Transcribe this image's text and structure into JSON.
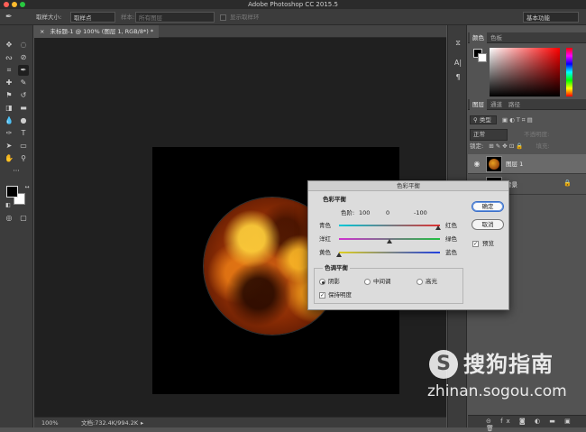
{
  "app": {
    "title": "Adobe Photoshop CC 2015.5"
  },
  "options_bar": {
    "sample_size_label": "取样大小:",
    "sample_size_value": "取样点",
    "sample_label": "样本:",
    "sample_value": "所有图层",
    "show_ring_label": "显示取样环",
    "workspace": "基本功能"
  },
  "document": {
    "tab_title": "未标题-1 @ 100% (图层 1, RGB/8*) *",
    "zoom": "100%",
    "doc_info": "文档:732.4K/994.2K"
  },
  "panels": {
    "color_tabs": [
      "颜色",
      "色板"
    ],
    "layers_tabs": [
      "图层",
      "通道",
      "路径"
    ],
    "kind_filter": "类型",
    "blend_mode": "正常",
    "opacity_label": "不透明度:",
    "lock_label": "锁定:",
    "fill_label": "填充:",
    "layers": [
      {
        "name": "图层 1",
        "selected": true
      },
      {
        "name": "背景",
        "selected": false
      }
    ]
  },
  "dialog": {
    "title": "色彩平衡",
    "section_balance": "色彩平衡",
    "levels_label": "色阶:",
    "levels": [
      "100",
      "0",
      "-100"
    ],
    "sliders": [
      {
        "left": "青色",
        "right": "红色",
        "value": 100
      },
      {
        "left": "洋红",
        "right": "绿色",
        "value": 0
      },
      {
        "left": "黄色",
        "right": "蓝色",
        "value": -100
      }
    ],
    "ok_button": "确定",
    "cancel_button": "取消",
    "preview_label": "预览",
    "preview_checked": true,
    "section_tone": "色调平衡",
    "tone_options": [
      "阴影",
      "中间调",
      "高光"
    ],
    "tone_selected": 0,
    "preserve_luminosity_label": "保持明度",
    "preserve_checked": true
  },
  "watermark": {
    "name": "搜狗指南",
    "url": "zhinan.sogou.com"
  }
}
